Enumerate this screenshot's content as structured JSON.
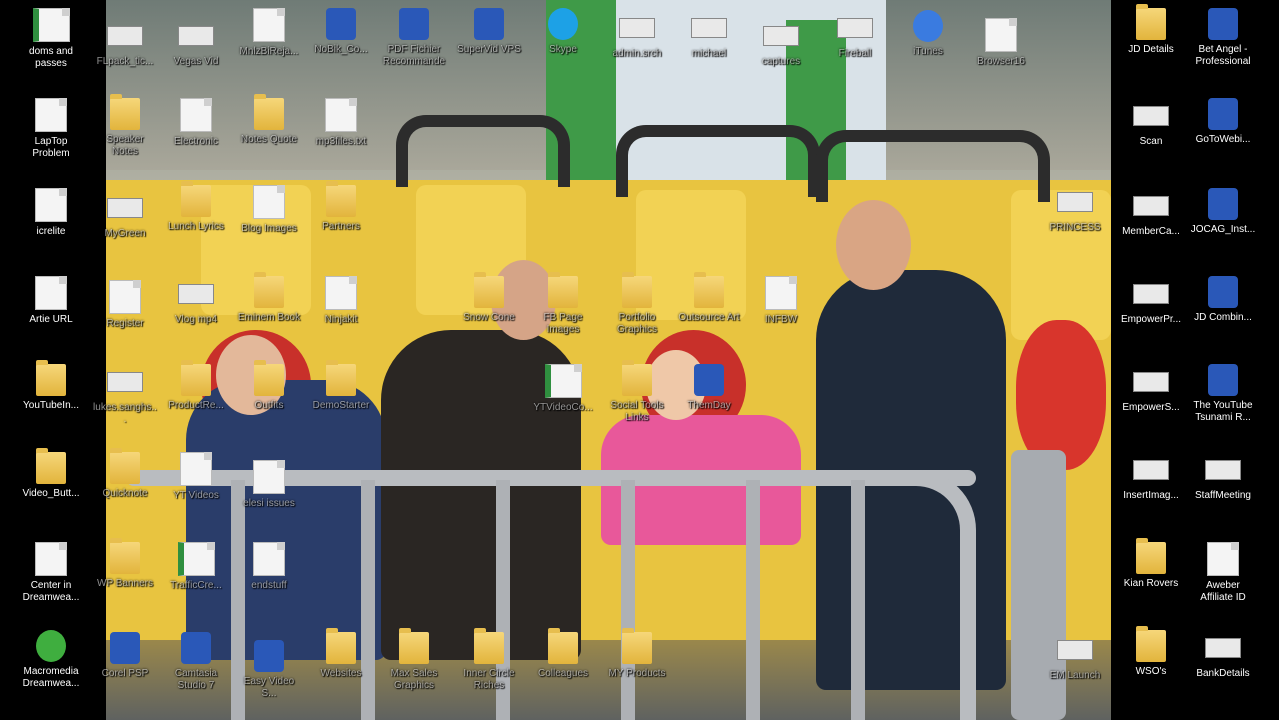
{
  "colors": {
    "bg": "#000000",
    "folder": "#e9bf4d",
    "doc": "#f4f4f4"
  },
  "desktop": {
    "left_column": [
      {
        "label": "doms and passes",
        "icon": "excel-icon"
      },
      {
        "label": "LapTop Problem",
        "icon": "document-icon"
      },
      {
        "label": "icrelite",
        "icon": "document-icon"
      },
      {
        "label": "Artie URL",
        "icon": "document-icon"
      },
      {
        "label": "YouTubeIn...",
        "icon": "folder-icon"
      },
      {
        "label": "Video_Butt...",
        "icon": "folder-icon"
      },
      {
        "label": "Center in Dreamwea...",
        "icon": "document-icon"
      },
      {
        "label": "Macromedia Dreamwea...",
        "icon": "dreamweaver-icon"
      }
    ],
    "wallpaper_icons": [
      {
        "label": "FLpack_tic...",
        "icon": "image-icon"
      },
      {
        "label": "Vegas Vid",
        "icon": "image-icon"
      },
      {
        "label": "MnlzBiReja...",
        "icon": "document-icon"
      },
      {
        "label": "NoBik_Co...",
        "icon": "app-icon"
      },
      {
        "label": "PDF Fichier Recommande",
        "icon": "app-icon"
      },
      {
        "label": "SuperVid VPS",
        "icon": "app-icon"
      },
      {
        "label": "Skype",
        "icon": "skype-icon"
      },
      {
        "label": "admin.srch",
        "icon": "image-icon"
      },
      {
        "label": "michael",
        "icon": "image-icon"
      },
      {
        "label": "captures",
        "icon": "image-icon"
      },
      {
        "label": "Fireball",
        "icon": "image-icon"
      },
      {
        "label": "iTunes",
        "icon": "itunes-icon"
      },
      {
        "label": "Browser16",
        "icon": "document-icon"
      },
      {
        "label": "Speaker Notes",
        "icon": "folder-icon"
      },
      {
        "label": "Electronic",
        "icon": "document-icon"
      },
      {
        "label": "Notes Quote",
        "icon": "folder-icon"
      },
      {
        "label": "mp3files.txt",
        "icon": "document-icon"
      },
      {
        "label": "MyGreen",
        "icon": "image-icon"
      },
      {
        "label": "Lunch Lyrics",
        "icon": "folder-icon"
      },
      {
        "label": "Partners",
        "icon": "folder-icon"
      },
      {
        "label": "Blog Images",
        "icon": "document-icon"
      },
      {
        "label": "Register",
        "icon": "document-icon"
      },
      {
        "label": "Vlog mp4",
        "icon": "image-icon"
      },
      {
        "label": "Eminem Book",
        "icon": "folder-icon"
      },
      {
        "label": "Ninjakit",
        "icon": "document-icon"
      },
      {
        "label": "Snow Cone",
        "icon": "folder-icon"
      },
      {
        "label": "FB Page Images",
        "icon": "folder-icon"
      },
      {
        "label": "Portfolio Graphics",
        "icon": "folder-icon"
      },
      {
        "label": "Outsource Art",
        "icon": "folder-icon"
      },
      {
        "label": "INFBW",
        "icon": "document-icon"
      },
      {
        "label": "lukes.sanghs...",
        "icon": "image-icon"
      },
      {
        "label": "ProductRe...",
        "icon": "folder-icon"
      },
      {
        "label": "Outfits",
        "icon": "folder-icon"
      },
      {
        "label": "DemoStarter",
        "icon": "folder-icon"
      },
      {
        "label": "YTVideoCo...",
        "icon": "excel-icon"
      },
      {
        "label": "Social Tools Links",
        "icon": "folder-icon"
      },
      {
        "label": "ThemDay",
        "icon": "app-icon"
      },
      {
        "label": "Quicknote",
        "icon": "folder-icon"
      },
      {
        "label": "YT Videos",
        "icon": "document-icon"
      },
      {
        "label": "elesi issues",
        "icon": "document-icon"
      },
      {
        "label": "WP Banners",
        "icon": "folder-icon"
      },
      {
        "label": "TrafficCre...",
        "icon": "excel-icon"
      },
      {
        "label": "endstuff",
        "icon": "document-icon"
      },
      {
        "label": "Corel PSP",
        "icon": "app-icon"
      },
      {
        "label": "Camtasia Studio 7",
        "icon": "app-icon"
      },
      {
        "label": "Easy Video S...",
        "icon": "app-icon"
      },
      {
        "label": "Websites",
        "icon": "folder-icon"
      },
      {
        "label": "Max Sales Graphics",
        "icon": "folder-icon"
      },
      {
        "label": "Inner Circle Riches",
        "icon": "folder-icon"
      },
      {
        "label": "Colleagues",
        "icon": "folder-icon"
      },
      {
        "label": "MY Products",
        "icon": "folder-icon"
      },
      {
        "label": "PRINCESS",
        "icon": "image-icon"
      },
      {
        "label": "EM Launch",
        "icon": "image-icon"
      }
    ],
    "right_column_a": [
      {
        "label": "JD Details",
        "icon": "folder-icon"
      },
      {
        "label": "Scan",
        "icon": "image-icon"
      },
      {
        "label": "MemberCa...",
        "icon": "image-icon"
      },
      {
        "label": "EmpowerPr...",
        "icon": "image-icon"
      },
      {
        "label": "EmpowerS...",
        "icon": "image-icon"
      },
      {
        "label": "InsertImag...",
        "icon": "image-icon"
      },
      {
        "label": "Kian Rovers",
        "icon": "folder-icon"
      },
      {
        "label": "WSO's",
        "icon": "folder-icon"
      }
    ],
    "right_column_b": [
      {
        "label": "Bet Angel - Professional",
        "icon": "app-icon"
      },
      {
        "label": "GoToWebi...",
        "icon": "app-icon"
      },
      {
        "label": "JOCAG_Inst...",
        "icon": "app-icon"
      },
      {
        "label": "JD Combin...",
        "icon": "app-icon"
      },
      {
        "label": "The YouTube Tsunami R...",
        "icon": "app-icon"
      },
      {
        "label": "StaffMeeting",
        "icon": "image-icon"
      },
      {
        "label": "Aweber Affiliate ID",
        "icon": "document-icon"
      },
      {
        "label": "BankDetails",
        "icon": "image-icon"
      }
    ]
  }
}
